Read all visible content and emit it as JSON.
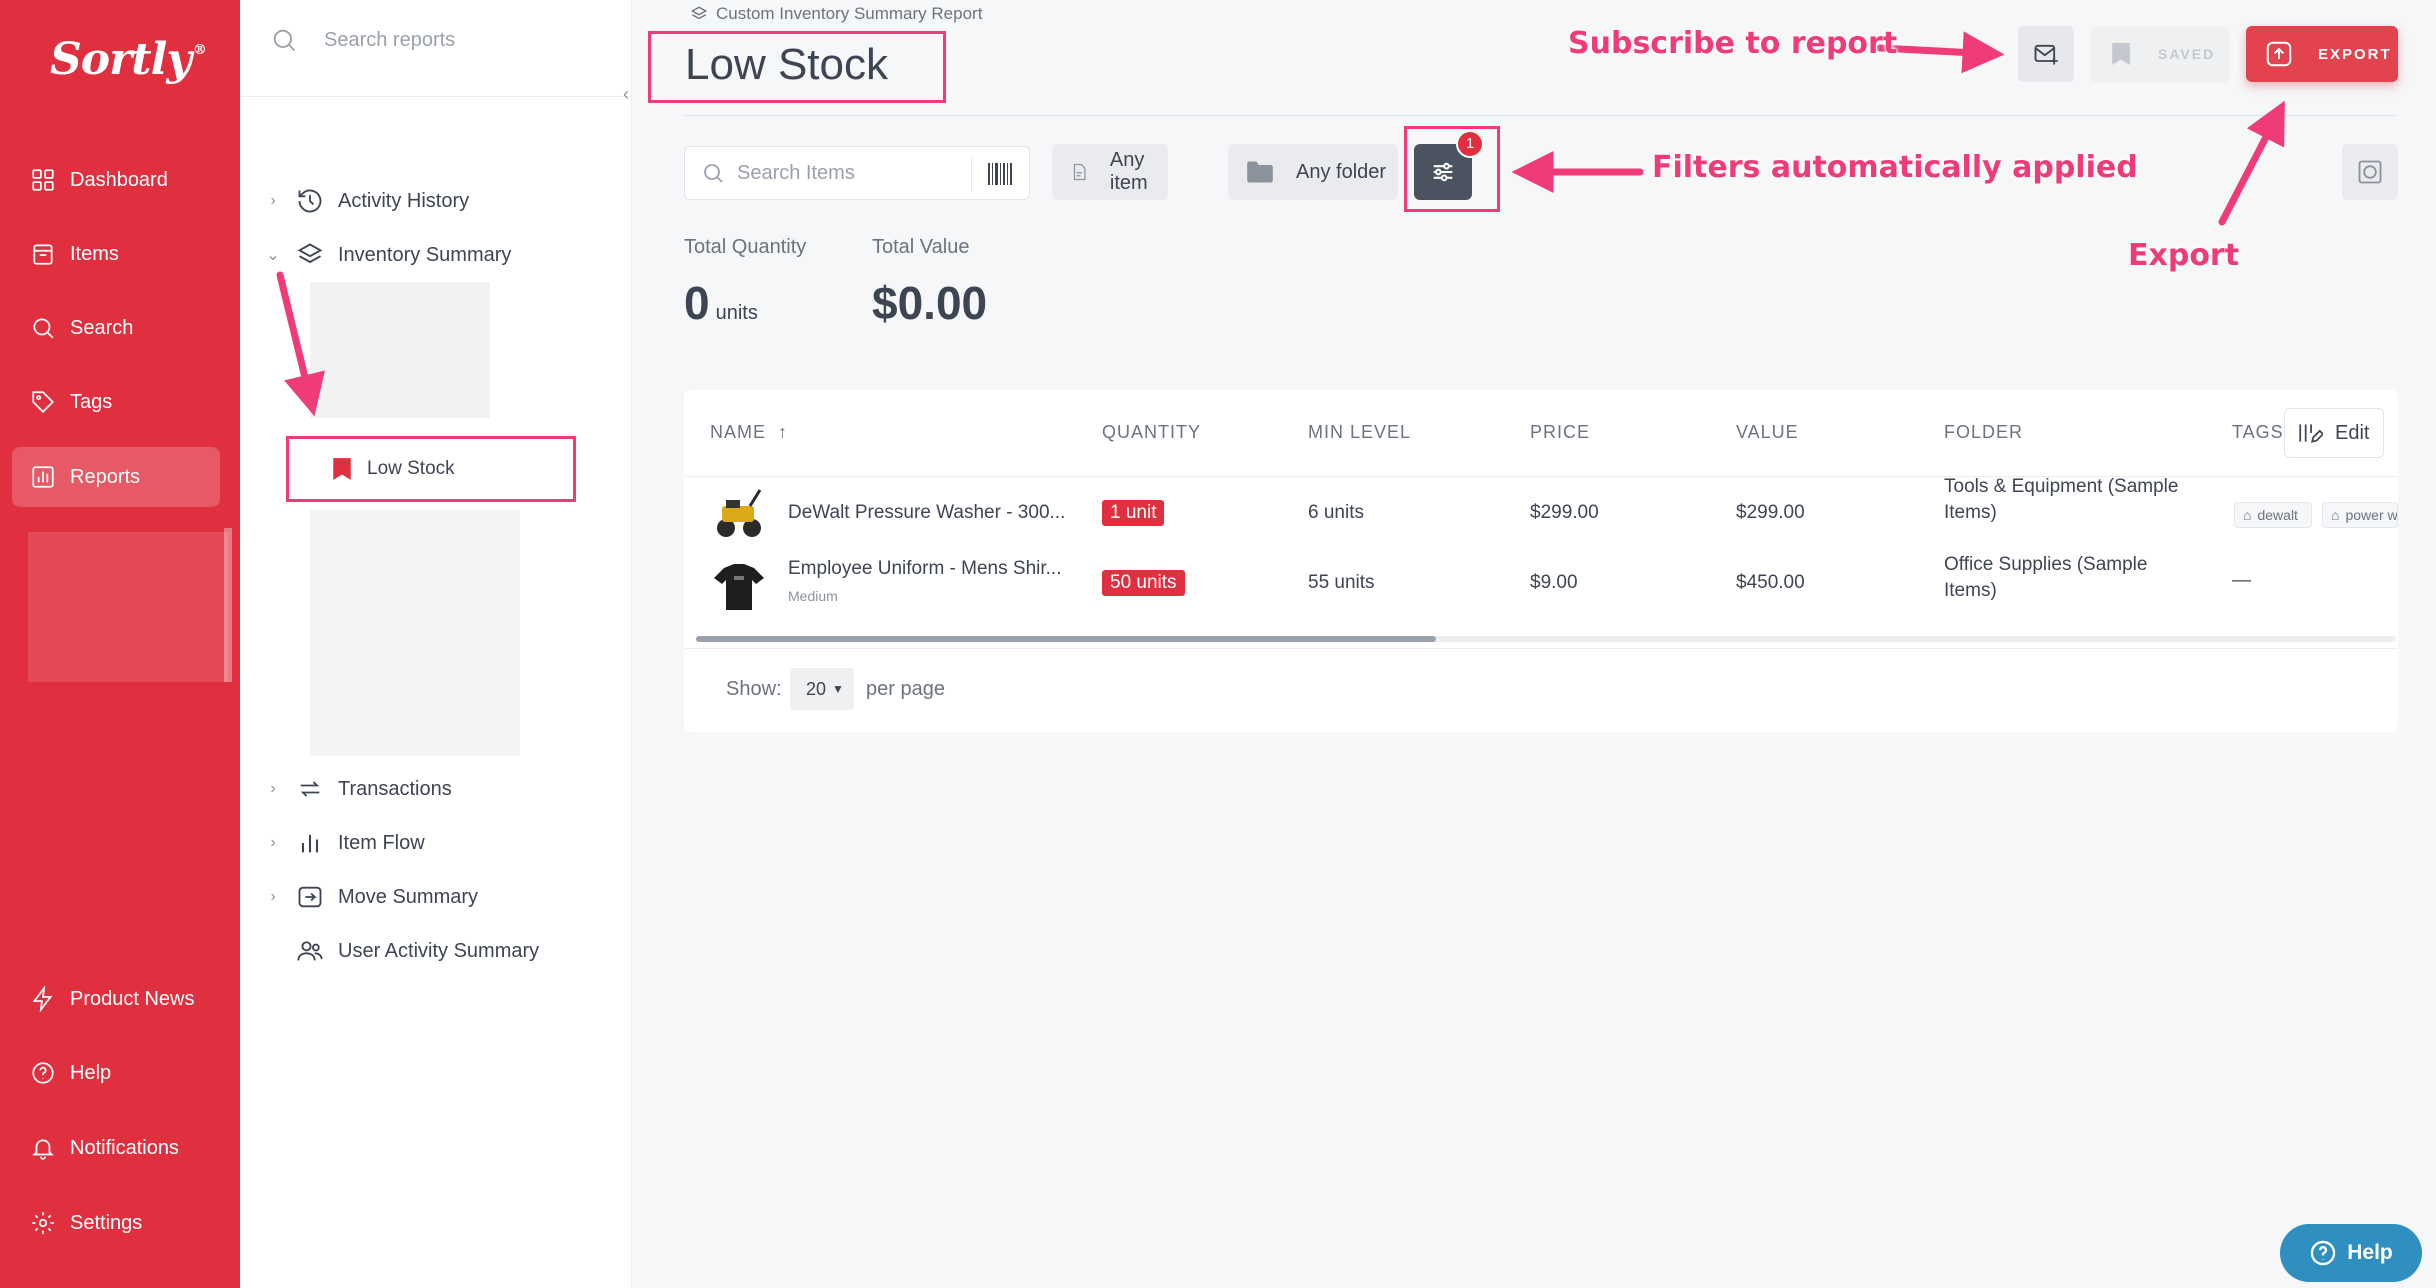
{
  "brand": {
    "logo": "Sortly",
    "logo_mark": "®",
    "accent": "#e0303f",
    "annotation": "#f03b7a"
  },
  "sidebar": {
    "items": [
      {
        "label": "Dashboard",
        "icon": "dashboard-icon"
      },
      {
        "label": "Items",
        "icon": "items-icon"
      },
      {
        "label": "Search",
        "icon": "search-icon"
      },
      {
        "label": "Tags",
        "icon": "tag-icon"
      },
      {
        "label": "Reports",
        "icon": "reports-icon",
        "active": true
      }
    ],
    "bottom": [
      {
        "label": "Product News",
        "icon": "lightning-icon"
      },
      {
        "label": "Help",
        "icon": "help-circle-icon"
      },
      {
        "label": "Notifications",
        "icon": "bell-icon"
      },
      {
        "label": "Settings",
        "icon": "gear-icon"
      }
    ]
  },
  "reports_panel": {
    "search_placeholder": "Search reports",
    "tree": [
      {
        "label": "Activity History",
        "icon": "history-icon",
        "expanded": false
      },
      {
        "label": "Inventory Summary",
        "icon": "layers-icon",
        "expanded": true
      },
      {
        "label": "Transactions",
        "icon": "transactions-icon",
        "expanded": false
      },
      {
        "label": "Item Flow",
        "icon": "bar-chart-icon",
        "expanded": false
      },
      {
        "label": "Move Summary",
        "icon": "move-icon",
        "expanded": false
      },
      {
        "label": "User Activity Summary",
        "icon": "users-icon"
      }
    ],
    "saved_report": "Low Stock"
  },
  "header": {
    "breadcrumb": "Custom Inventory Summary Report",
    "title": "Low Stock",
    "saved_label": "SAVED",
    "export_label": "EXPORT"
  },
  "filters": {
    "search_placeholder": "Search Items",
    "item_filter": "Any item",
    "folder_filter": "Any folder",
    "active_filter_count": "1"
  },
  "stats": {
    "quantity_label": "Total Quantity",
    "quantity_value": "0",
    "quantity_unit": "units",
    "value_label": "Total Value",
    "value_value": "$0.00"
  },
  "table": {
    "columns": [
      "NAME",
      "QUANTITY",
      "MIN LEVEL",
      "PRICE",
      "VALUE",
      "FOLDER",
      "TAGS"
    ],
    "edit_label": "Edit",
    "rows": [
      {
        "name": "DeWalt Pressure Washer - 300...",
        "variant": "",
        "quantity": "1 unit",
        "min_level": "6 units",
        "price": "$299.00",
        "value": "$299.00",
        "folder": [
          "Tools & Equipment (Sample",
          "Items)"
        ],
        "tags": [
          "dewalt",
          "power w"
        ]
      },
      {
        "name": "Employee Uniform - Mens Shir...",
        "variant": "Medium",
        "quantity": "50 units",
        "min_level": "55 units",
        "price": "$9.00",
        "value": "$450.00",
        "folder": [
          "Office Supplies (Sample",
          "Items)"
        ],
        "tags_empty": "—"
      }
    ],
    "show_label": "Show:",
    "per_page_value": "20",
    "per_page_label": "per page"
  },
  "help_button": "Help",
  "annotations": {
    "subscribe": "Subscribe to report",
    "filters": "Filters automatically applied",
    "export": "Export"
  }
}
